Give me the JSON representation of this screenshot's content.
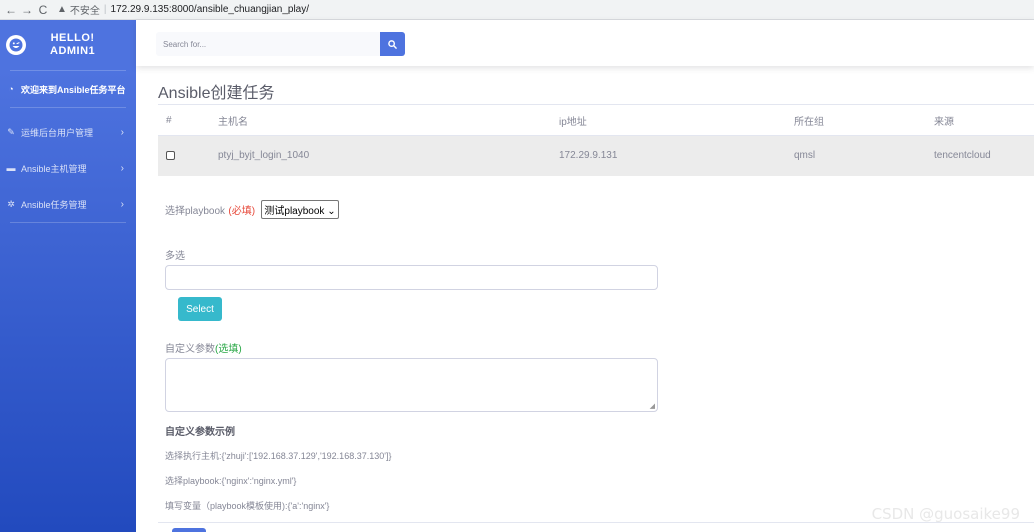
{
  "browser": {
    "insecure_label": "不安全",
    "url": "172.29.9.135:8000/ansible_chuangjian_play/"
  },
  "sidebar": {
    "brand_line1": "HELLO!",
    "brand_line2": "ADMIN1",
    "items": [
      {
        "label": "欢迎来到Ansible任务平台",
        "icon": "tachometer-icon"
      },
      {
        "label": "运维后台用户管理",
        "icon": "wrench-icon"
      },
      {
        "label": "Ansible主机管理",
        "icon": "folder-icon"
      },
      {
        "label": "Ansible任务管理",
        "icon": "cog-icon"
      }
    ]
  },
  "topbar": {
    "search_placeholder": "Search for..."
  },
  "page": {
    "title": "Ansible创建任务"
  },
  "table": {
    "headers": [
      "#",
      "主机名",
      "ip地址",
      "所在组",
      "来源"
    ],
    "rows": [
      {
        "hostname": "ptyj_byjt_login_1040",
        "ip": "172.29.9.131",
        "group": "qmsl",
        "source": "tencentcloud"
      }
    ]
  },
  "form": {
    "playbook_label": "选择playbook",
    "required_tag": "(必填)",
    "playbook_selected": "测试playbook",
    "multi_label": "多选",
    "select_button": "Select",
    "custom_label": "自定义参数",
    "optional_tag": "(选填)",
    "example_title": "自定义参数示例",
    "examples": [
      "选择执行主机:{'zhuji':['192.168.37.129','192.168.37.130']}",
      "选择playbook:{'nginx':'nginx.yml'}",
      "填写变量（playbook模板使用):{'a':'nginx'}"
    ]
  },
  "watermark": "CSDN @guosaike99"
}
